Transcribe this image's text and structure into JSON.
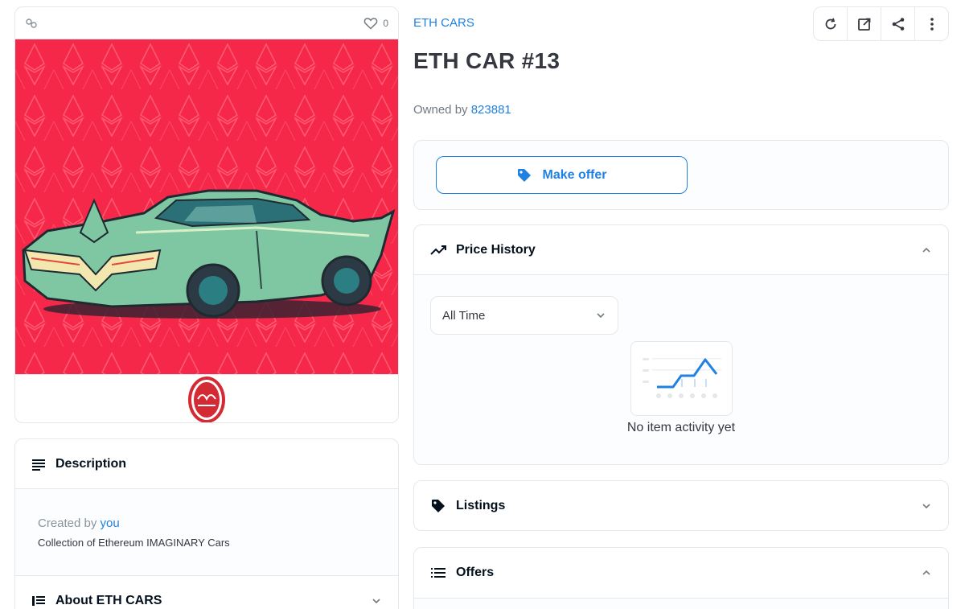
{
  "header": {
    "collection": "ETH CARS",
    "title": "ETH CAR #13",
    "owned_prefix": "Owned by",
    "owner": "823881"
  },
  "media": {
    "like_count": "0",
    "icons": [
      "chain-icon",
      "heart-icon"
    ],
    "art_colors": {
      "background": "#f6284a",
      "car_body": "#7fc6a2",
      "tires": "#2b3a44"
    }
  },
  "toolbar": {
    "icons": [
      "refresh-icon",
      "external-link-icon",
      "share-icon",
      "more-vertical-icon"
    ]
  },
  "offer": {
    "make_offer_label": "Make offer"
  },
  "price_history": {
    "title": "Price History",
    "range_selected": "All Time",
    "empty_text": "No item activity yet"
  },
  "listings": {
    "title": "Listings"
  },
  "offers": {
    "title": "Offers"
  },
  "description": {
    "title": "Description",
    "created_prefix": "Created by",
    "created_by": "you",
    "text": "Collection of Ethereum IMAGINARY Cars"
  },
  "about": {
    "title": "About ETH CARS"
  },
  "colors": {
    "accent": "#2081e2",
    "text": "#353840",
    "border": "#e5e8eb"
  }
}
